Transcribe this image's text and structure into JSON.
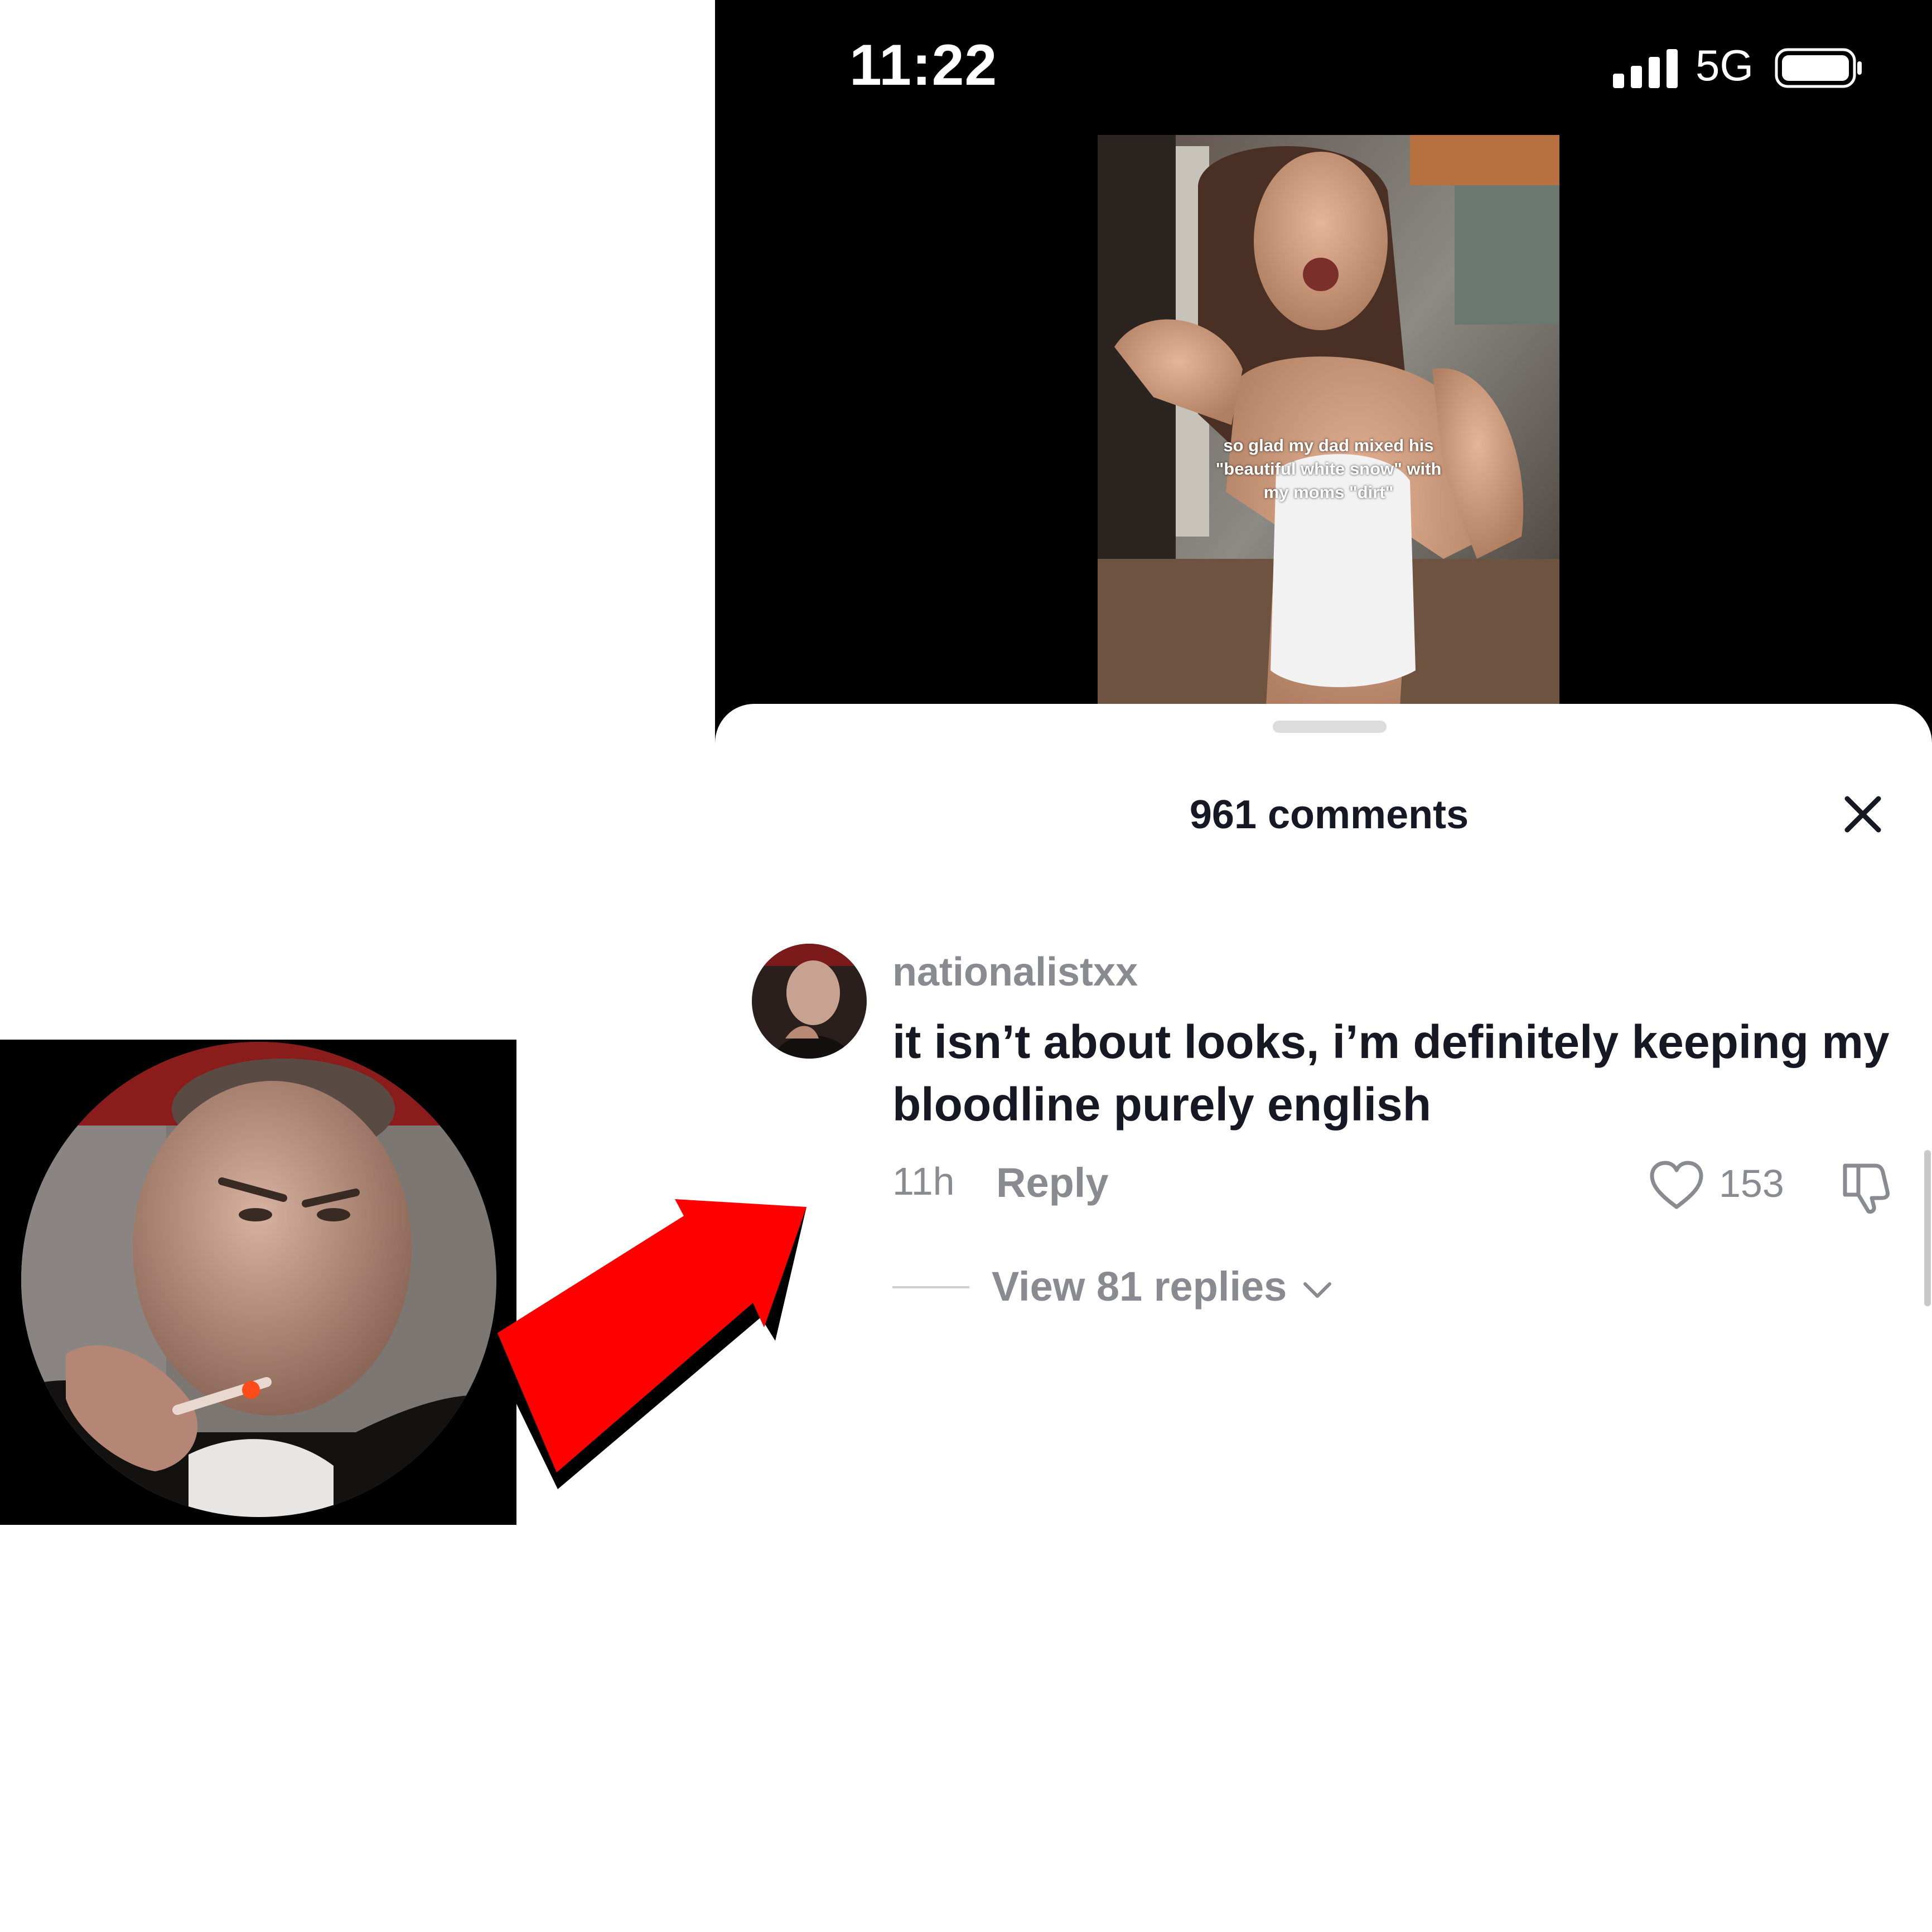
{
  "status_bar": {
    "time": "11:22",
    "network": "5G"
  },
  "video": {
    "caption_lines": [
      "so glad my dad mixed his",
      "\"beautiful white snow\" with",
      "my moms \"dirt\""
    ]
  },
  "comments_sheet": {
    "title": "961 comments",
    "close_icon": "close-icon",
    "comment": {
      "username": "nationalistxx",
      "text": "it isn’t about looks, i’m definitely keeping my bloodline purely english",
      "time": "11h",
      "reply_label": "Reply",
      "like_count": "153",
      "view_replies_label": "View 81 replies"
    }
  },
  "annotation": {
    "arrow_color": "#ff0000",
    "arrow_shadow_color": "#000000"
  },
  "colors": {
    "text_primary": "#161823",
    "text_secondary": "#8a8b91",
    "sheet_background": "#ffffff",
    "phone_background": "#000000"
  }
}
